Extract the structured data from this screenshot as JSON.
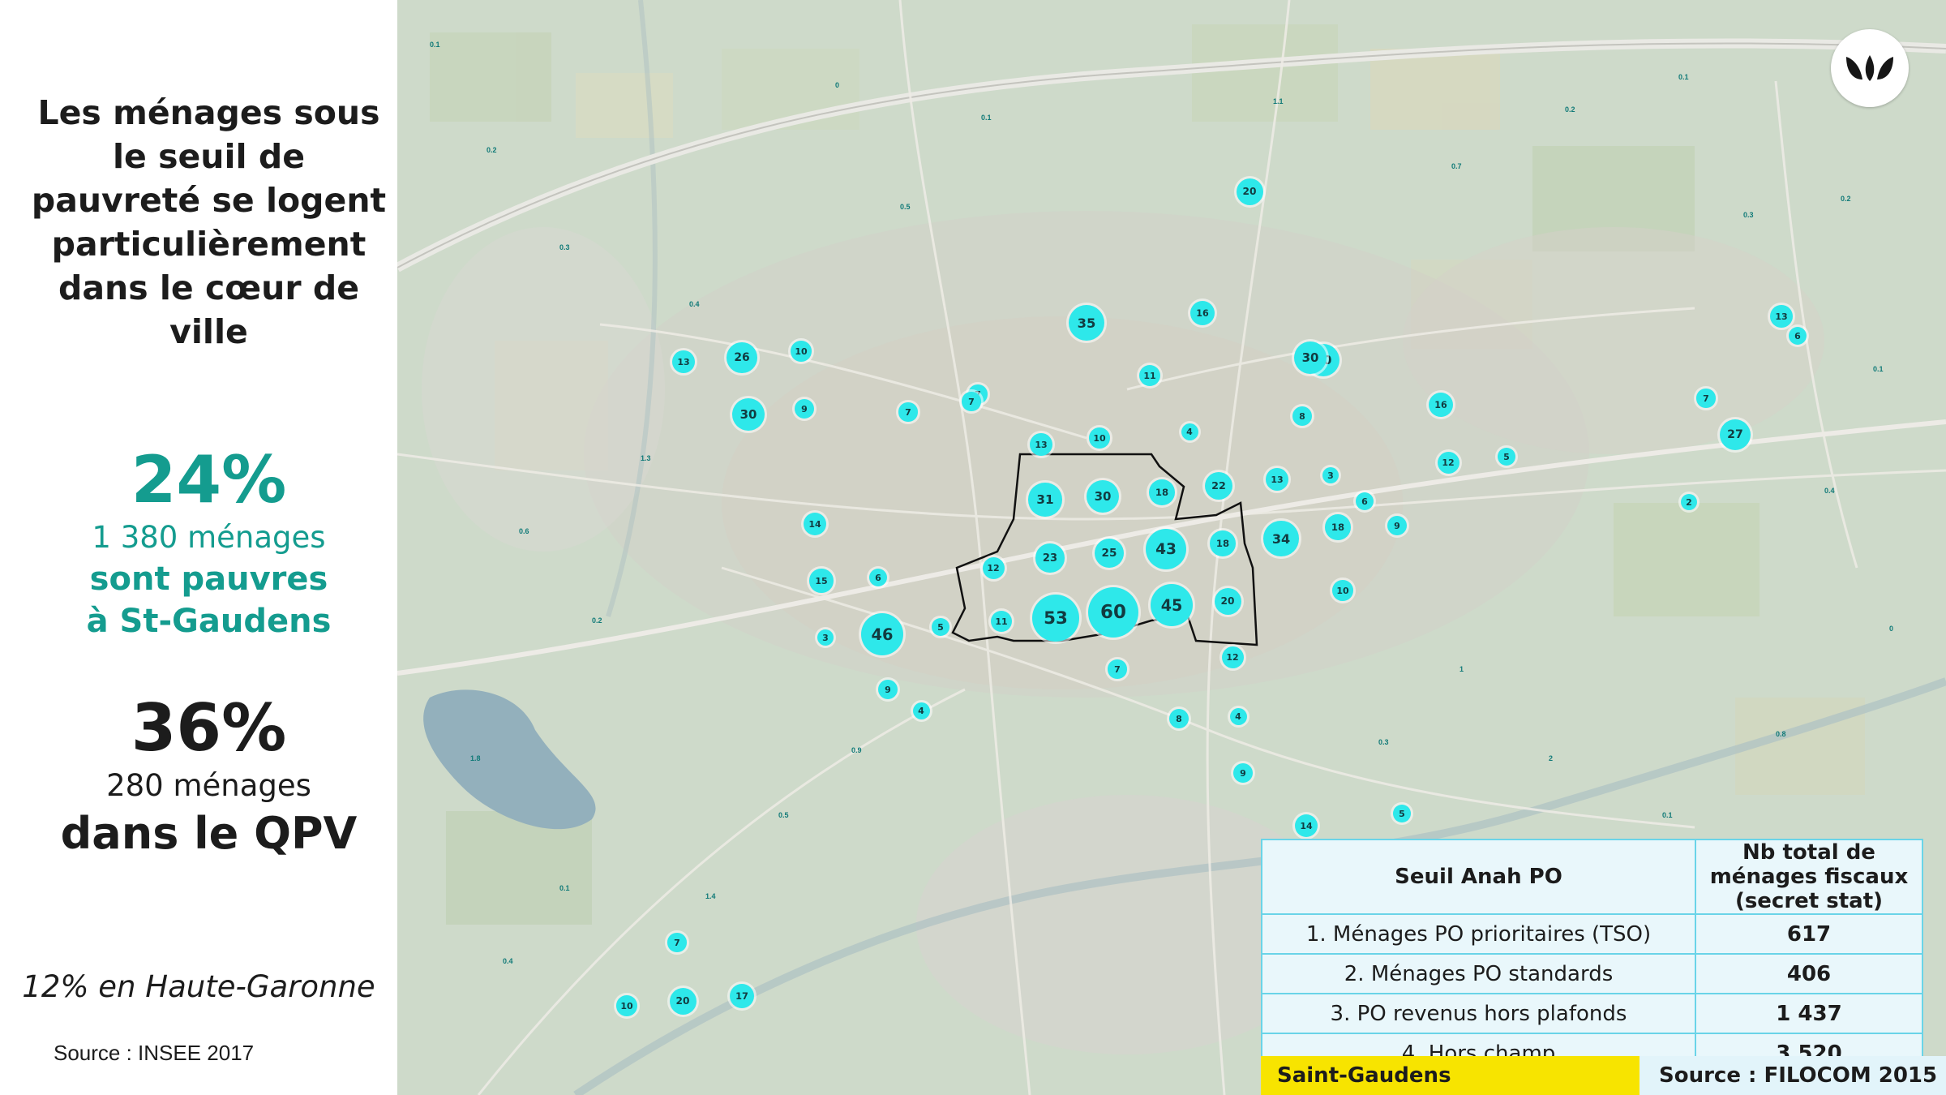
{
  "headline": "Les ménages sous le seuil de pauvreté se logent particulièrement dans le cœur de ville",
  "stat_city": {
    "percent": "24%",
    "count": "1 380 ménages",
    "line2": "sont pauvres",
    "line3": "à St-Gaudens",
    "color": "#149c8f"
  },
  "stat_qpv": {
    "percent": "36%",
    "count": "280 ménages",
    "line2": "dans le QPV",
    "color": "#1c1c1c"
  },
  "dept_note": "12% en Haute-Garonne",
  "source_left": "Source : INSEE 2017",
  "map": {
    "bubble_color": "#2ee8ea",
    "logo_icon": "brand-leaf-logo-icon",
    "bubbles": [
      "20",
      "35",
      "16",
      "30",
      "13",
      "13",
      "26",
      "10",
      "30",
      "9",
      "11",
      "27",
      "7",
      "16",
      "7",
      "6",
      "30",
      "13",
      "10",
      "4",
      "8",
      "7",
      "7",
      "12",
      "5",
      "31",
      "30",
      "18",
      "22",
      "13",
      "3",
      "14",
      "6",
      "2",
      "18",
      "9",
      "23",
      "25",
      "43",
      "18",
      "34",
      "12",
      "15",
      "6",
      "11",
      "53",
      "60",
      "45",
      "20",
      "10",
      "46",
      "5",
      "3",
      "12",
      "7",
      "9",
      "8",
      "4",
      "4",
      "9",
      "14",
      "5",
      "20",
      "17",
      "10",
      "7"
    ],
    "small_values": [
      "0.1",
      "0.2",
      "0.3",
      "0.4",
      "0",
      "0.5",
      "0.1",
      "1.1",
      "0.7",
      "0.2",
      "0.1",
      "0.3",
      "0.2",
      "0.1",
      "0.4",
      "0",
      "0.8",
      "0.1",
      "2",
      "1",
      "0.3",
      "0.6",
      "0.2",
      "1.8",
      "0.1",
      "0.4",
      "1.4",
      "0.5",
      "0.9",
      "1.3"
    ]
  },
  "table": {
    "header_a": "Seuil Anah PO",
    "header_b": "Nb total de ménages fiscaux (secret stat)",
    "rows": [
      {
        "label": "1. Ménages PO prioritaires (TSO)",
        "value": "617"
      },
      {
        "label": "2. Ménages PO standards",
        "value": "406"
      },
      {
        "label": "3. PO revenus hors plafonds",
        "value": "1 437"
      },
      {
        "label": "4. Hors champ",
        "value": "3 520"
      }
    ]
  },
  "commune": "Saint-Gaudens",
  "commune_color": "#f7e400",
  "source_right": "Source : FILOCOM 2015"
}
